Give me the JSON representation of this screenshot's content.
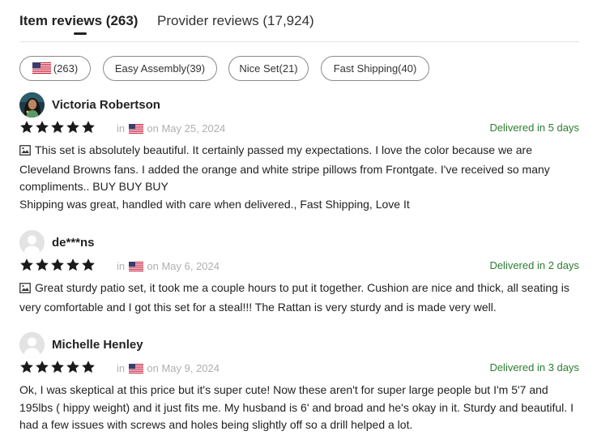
{
  "tabs": [
    {
      "label": "Item reviews (263)",
      "active": true
    },
    {
      "label": "Provider reviews (17,924)",
      "active": false
    }
  ],
  "filters": {
    "flag_count": "(263)",
    "flag_icon": "us-flag-icon",
    "chips": [
      "Easy Assembly(39)",
      "Nice Set(21)",
      "Fast Shipping(40)"
    ]
  },
  "colors": {
    "delivered": "#2e7d32",
    "star": "#1a1a1a",
    "meta": "#b0b0b0"
  },
  "reviews": [
    {
      "name": "Victoria Robertson",
      "rating": 5,
      "in_label": "in",
      "date": "on May 25, 2024",
      "delivered": "Delivered in 5 days",
      "has_image_icon": true,
      "text": "This set is absolutely beautiful. It certainly passed my expectations. I love the color because we are Cleveland Browns fans. I added the orange and white stripe pillows from Frontgate. I've received so many compliments.. BUY BUY BUY",
      "extra": "Shipping was great, handled with care when delivered., Fast Shipping, Love It"
    },
    {
      "name": "de***ns",
      "rating": 5,
      "in_label": "in",
      "date": "on May 6, 2024",
      "delivered": "Delivered in 2 days",
      "has_image_icon": true,
      "text": "Great sturdy patio set, it took me a couple hours to put it together. Cushion are nice and thick, all seating is very comfortable and I got this set for a steal!!! The Rattan is very sturdy and is made very well."
    },
    {
      "name": "Michelle Henley",
      "rating": 5,
      "in_label": "in",
      "date": "on May 9, 2024",
      "delivered": "Delivered in 3 days",
      "has_image_icon": false,
      "text": "Ok, I was skeptical at this price but it's super cute! Now these aren't for super large people but I'm 5'7 and 195lbs ( hippy weight) and it just fits me. My husband is 6' and broad and he's okay in it. Sturdy and beautiful. I had a few issues with screws and holes being slightly off so a drill helped a lot."
    }
  ]
}
